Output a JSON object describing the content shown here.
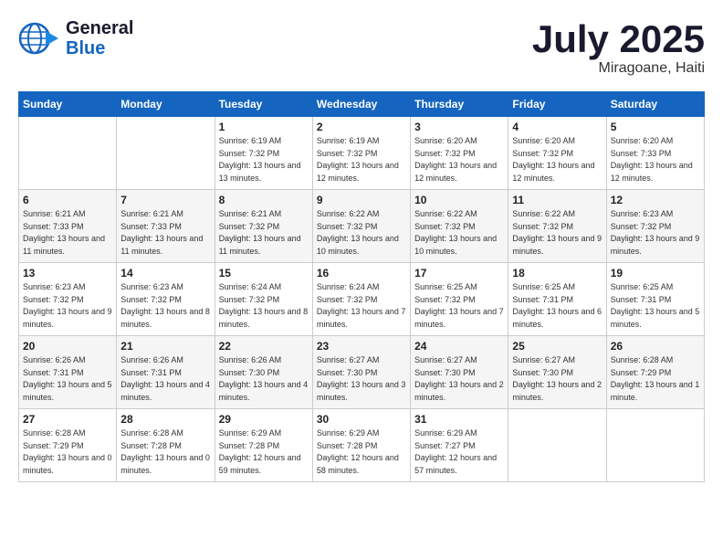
{
  "logo": {
    "line1": "General",
    "line2": "Blue"
  },
  "title": {
    "month_year": "July 2025",
    "location": "Miragoane, Haiti"
  },
  "header_days": [
    "Sunday",
    "Monday",
    "Tuesday",
    "Wednesday",
    "Thursday",
    "Friday",
    "Saturday"
  ],
  "weeks": [
    [
      {
        "day": "",
        "sunrise": "",
        "sunset": "",
        "daylight": ""
      },
      {
        "day": "",
        "sunrise": "",
        "sunset": "",
        "daylight": ""
      },
      {
        "day": "1",
        "sunrise": "Sunrise: 6:19 AM",
        "sunset": "Sunset: 7:32 PM",
        "daylight": "Daylight: 13 hours and 13 minutes."
      },
      {
        "day": "2",
        "sunrise": "Sunrise: 6:19 AM",
        "sunset": "Sunset: 7:32 PM",
        "daylight": "Daylight: 13 hours and 12 minutes."
      },
      {
        "day": "3",
        "sunrise": "Sunrise: 6:20 AM",
        "sunset": "Sunset: 7:32 PM",
        "daylight": "Daylight: 13 hours and 12 minutes."
      },
      {
        "day": "4",
        "sunrise": "Sunrise: 6:20 AM",
        "sunset": "Sunset: 7:32 PM",
        "daylight": "Daylight: 13 hours and 12 minutes."
      },
      {
        "day": "5",
        "sunrise": "Sunrise: 6:20 AM",
        "sunset": "Sunset: 7:33 PM",
        "daylight": "Daylight: 13 hours and 12 minutes."
      }
    ],
    [
      {
        "day": "6",
        "sunrise": "Sunrise: 6:21 AM",
        "sunset": "Sunset: 7:33 PM",
        "daylight": "Daylight: 13 hours and 11 minutes."
      },
      {
        "day": "7",
        "sunrise": "Sunrise: 6:21 AM",
        "sunset": "Sunset: 7:33 PM",
        "daylight": "Daylight: 13 hours and 11 minutes."
      },
      {
        "day": "8",
        "sunrise": "Sunrise: 6:21 AM",
        "sunset": "Sunset: 7:32 PM",
        "daylight": "Daylight: 13 hours and 11 minutes."
      },
      {
        "day": "9",
        "sunrise": "Sunrise: 6:22 AM",
        "sunset": "Sunset: 7:32 PM",
        "daylight": "Daylight: 13 hours and 10 minutes."
      },
      {
        "day": "10",
        "sunrise": "Sunrise: 6:22 AM",
        "sunset": "Sunset: 7:32 PM",
        "daylight": "Daylight: 13 hours and 10 minutes."
      },
      {
        "day": "11",
        "sunrise": "Sunrise: 6:22 AM",
        "sunset": "Sunset: 7:32 PM",
        "daylight": "Daylight: 13 hours and 9 minutes."
      },
      {
        "day": "12",
        "sunrise": "Sunrise: 6:23 AM",
        "sunset": "Sunset: 7:32 PM",
        "daylight": "Daylight: 13 hours and 9 minutes."
      }
    ],
    [
      {
        "day": "13",
        "sunrise": "Sunrise: 6:23 AM",
        "sunset": "Sunset: 7:32 PM",
        "daylight": "Daylight: 13 hours and 9 minutes."
      },
      {
        "day": "14",
        "sunrise": "Sunrise: 6:23 AM",
        "sunset": "Sunset: 7:32 PM",
        "daylight": "Daylight: 13 hours and 8 minutes."
      },
      {
        "day": "15",
        "sunrise": "Sunrise: 6:24 AM",
        "sunset": "Sunset: 7:32 PM",
        "daylight": "Daylight: 13 hours and 8 minutes."
      },
      {
        "day": "16",
        "sunrise": "Sunrise: 6:24 AM",
        "sunset": "Sunset: 7:32 PM",
        "daylight": "Daylight: 13 hours and 7 minutes."
      },
      {
        "day": "17",
        "sunrise": "Sunrise: 6:25 AM",
        "sunset": "Sunset: 7:32 PM",
        "daylight": "Daylight: 13 hours and 7 minutes."
      },
      {
        "day": "18",
        "sunrise": "Sunrise: 6:25 AM",
        "sunset": "Sunset: 7:31 PM",
        "daylight": "Daylight: 13 hours and 6 minutes."
      },
      {
        "day": "19",
        "sunrise": "Sunrise: 6:25 AM",
        "sunset": "Sunset: 7:31 PM",
        "daylight": "Daylight: 13 hours and 5 minutes."
      }
    ],
    [
      {
        "day": "20",
        "sunrise": "Sunrise: 6:26 AM",
        "sunset": "Sunset: 7:31 PM",
        "daylight": "Daylight: 13 hours and 5 minutes."
      },
      {
        "day": "21",
        "sunrise": "Sunrise: 6:26 AM",
        "sunset": "Sunset: 7:31 PM",
        "daylight": "Daylight: 13 hours and 4 minutes."
      },
      {
        "day": "22",
        "sunrise": "Sunrise: 6:26 AM",
        "sunset": "Sunset: 7:30 PM",
        "daylight": "Daylight: 13 hours and 4 minutes."
      },
      {
        "day": "23",
        "sunrise": "Sunrise: 6:27 AM",
        "sunset": "Sunset: 7:30 PM",
        "daylight": "Daylight: 13 hours and 3 minutes."
      },
      {
        "day": "24",
        "sunrise": "Sunrise: 6:27 AM",
        "sunset": "Sunset: 7:30 PM",
        "daylight": "Daylight: 13 hours and 2 minutes."
      },
      {
        "day": "25",
        "sunrise": "Sunrise: 6:27 AM",
        "sunset": "Sunset: 7:30 PM",
        "daylight": "Daylight: 13 hours and 2 minutes."
      },
      {
        "day": "26",
        "sunrise": "Sunrise: 6:28 AM",
        "sunset": "Sunset: 7:29 PM",
        "daylight": "Daylight: 13 hours and 1 minute."
      }
    ],
    [
      {
        "day": "27",
        "sunrise": "Sunrise: 6:28 AM",
        "sunset": "Sunset: 7:29 PM",
        "daylight": "Daylight: 13 hours and 0 minutes."
      },
      {
        "day": "28",
        "sunrise": "Sunrise: 6:28 AM",
        "sunset": "Sunset: 7:28 PM",
        "daylight": "Daylight: 13 hours and 0 minutes."
      },
      {
        "day": "29",
        "sunrise": "Sunrise: 6:29 AM",
        "sunset": "Sunset: 7:28 PM",
        "daylight": "Daylight: 12 hours and 59 minutes."
      },
      {
        "day": "30",
        "sunrise": "Sunrise: 6:29 AM",
        "sunset": "Sunset: 7:28 PM",
        "daylight": "Daylight: 12 hours and 58 minutes."
      },
      {
        "day": "31",
        "sunrise": "Sunrise: 6:29 AM",
        "sunset": "Sunset: 7:27 PM",
        "daylight": "Daylight: 12 hours and 57 minutes."
      },
      {
        "day": "",
        "sunrise": "",
        "sunset": "",
        "daylight": ""
      },
      {
        "day": "",
        "sunrise": "",
        "sunset": "",
        "daylight": ""
      }
    ]
  ]
}
